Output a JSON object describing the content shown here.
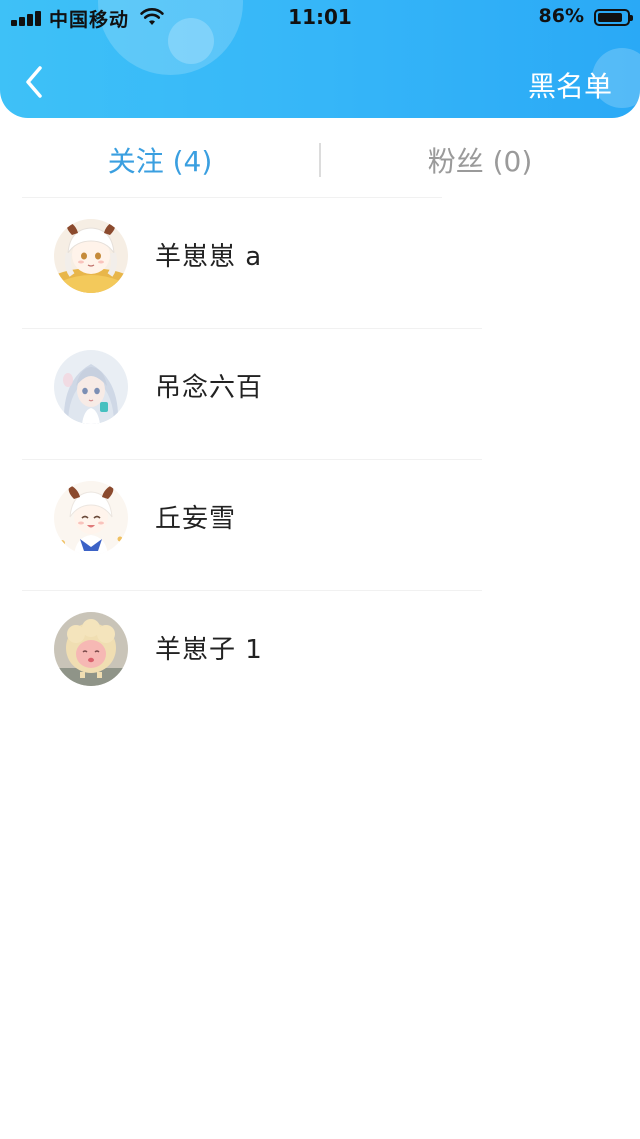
{
  "status_bar": {
    "carrier": "中国移动",
    "time": "11:01",
    "battery_percent": "86%",
    "battery_level": 0.86,
    "signal_bars": 4,
    "wifi_icon": "wifi-icon"
  },
  "header": {
    "back_icon": "chevron-left-icon",
    "blacklist_label": "黑名单",
    "gradient_start": "#3ec1f7",
    "gradient_end": "#2aa9f6"
  },
  "tabs": {
    "following_label": "关注 (4)",
    "fans_label": "粉丝 (0)",
    "active": "following",
    "active_color": "#3a9fe0",
    "inactive_color": "#9a9a9a"
  },
  "following": [
    {
      "name": "羊崽崽 a",
      "avatar": "anime-girl-sheep-horns"
    },
    {
      "name": "吊念六百",
      "avatar": "anime-girl-silver-hair"
    },
    {
      "name": "丘妄雪",
      "avatar": "anime-girl-sheep-horns-smiling"
    },
    {
      "name": "羊崽子 1",
      "avatar": "cartoon-sheep"
    }
  ]
}
